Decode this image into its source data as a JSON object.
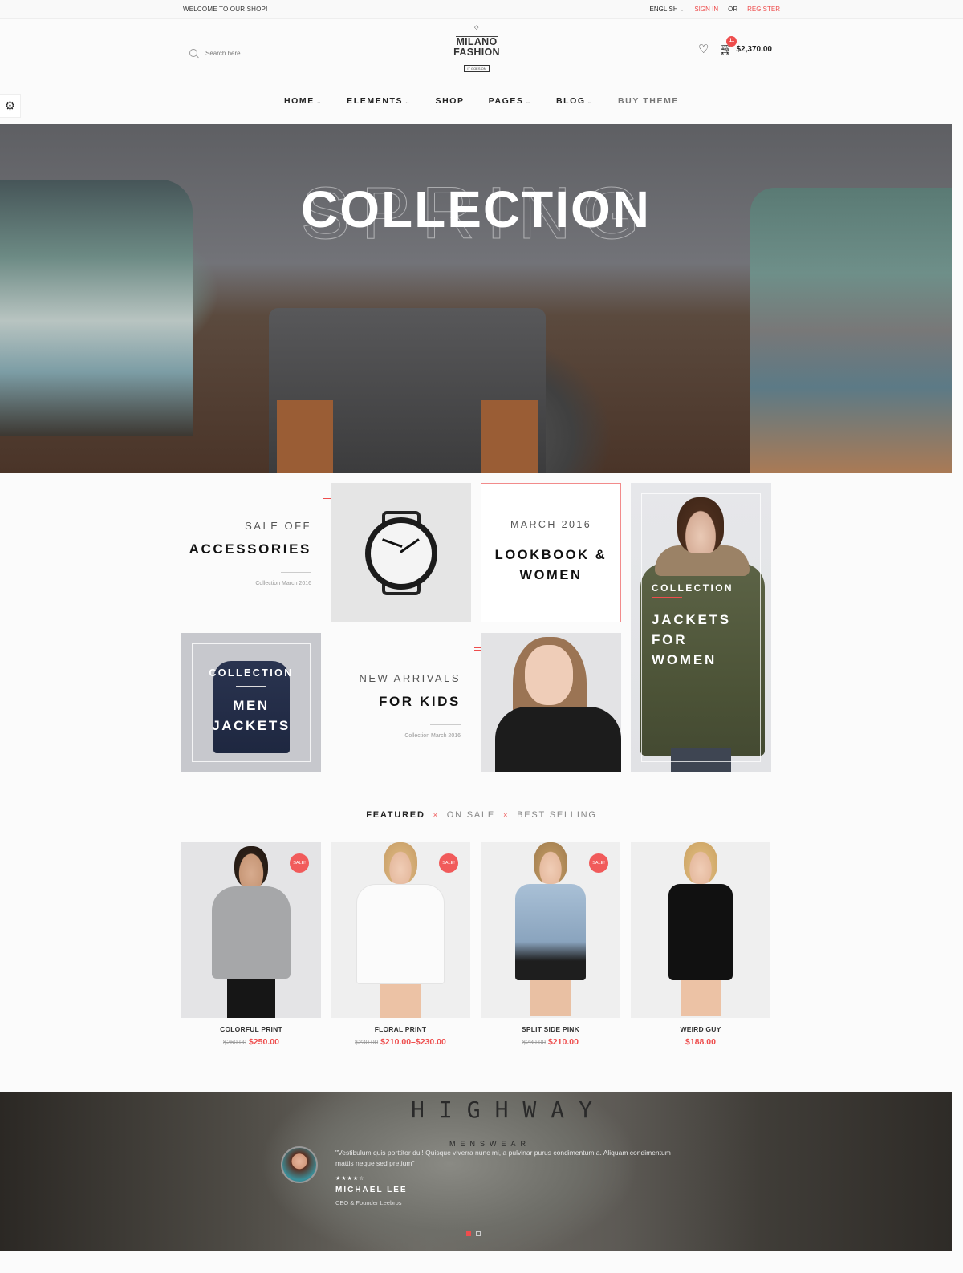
{
  "topbar": {
    "welcome": "WELCOME TO OUR SHOP!",
    "language": "ENGLISH",
    "sign_in": "SIGN IN",
    "or": "OR",
    "register": "REGISTER"
  },
  "header": {
    "search_placeholder": "Search here",
    "logo_line1": "MILANO",
    "logo_line2": "FASHION",
    "logo_tagline": "IT GOES ON",
    "wishlist_icon": "heart-icon",
    "cart_icon": "cart-icon",
    "cart_count": "11",
    "cart_total": "$2,370.00"
  },
  "nav": {
    "items": [
      {
        "label": "HOME",
        "dropdown": true
      },
      {
        "label": "ELEMENTS",
        "dropdown": true
      },
      {
        "label": "SHOP",
        "dropdown": false
      },
      {
        "label": "PAGES",
        "dropdown": true
      },
      {
        "label": "BLOG",
        "dropdown": true
      },
      {
        "label": "BUY THEME",
        "dropdown": false
      }
    ]
  },
  "settings_icon": "gear-icon",
  "hero": {
    "background_word": "SPRING",
    "title": "COLLECTION"
  },
  "promos": {
    "accessories": {
      "kicker": "SALE OFF",
      "title": "ACCESSORIES",
      "subtitle": "Collection March 2016"
    },
    "lookbook": {
      "kicker": "MARCH 2016",
      "title_line1": "LOOKBOOK &",
      "title_line2": "WOMEN"
    },
    "jackets_women": {
      "kicker": "COLLECTION",
      "title_line1": "JACKETS",
      "title_line2": "FOR",
      "title_line3": "WOMEN"
    },
    "men_jackets": {
      "kicker": "COLLECTION",
      "title_line1": "MEN",
      "title_line2": "JACKETS"
    },
    "kids": {
      "kicker": "NEW ARRIVALS",
      "title": "FOR KIDS",
      "subtitle": "Collection March 2016"
    }
  },
  "product_tabs": {
    "items": [
      "FEATURED",
      "ON SALE",
      "BEST SELLING"
    ],
    "separator": "×",
    "active": "FEATURED"
  },
  "products": [
    {
      "name": "COLORFUL PRINT",
      "old_price": "$260.00",
      "price": "$250.00",
      "sale": true
    },
    {
      "name": "FLORAL PRINT",
      "old_price": "$230.00",
      "price": "$210.00–$230.00",
      "sale": true
    },
    {
      "name": "SPLIT SIDE PINK",
      "old_price": "$230.00",
      "price": "$210.00",
      "sale": true
    },
    {
      "name": "WEIRD GUY",
      "old_price": null,
      "price": "$188.00",
      "sale": false
    }
  ],
  "sale_badge": "SALE!",
  "testimonial": {
    "sign_text": "HIGHWAY",
    "sign_sub": "MENSWEAR",
    "quote": "\"Vestibulum quis porttitor dui! Quisque viverra nunc mi, a pulvinar purus condimentum a. Aliquam condimentum mattis neque sed pretium\"",
    "rating": 4,
    "rating_max": 5,
    "stars": "★★★★☆",
    "author": "MICHAEL LEE",
    "role": "CEO & Founder Leebros",
    "slide_active": 1,
    "slide_count": 2
  },
  "colors": {
    "accent": "#ee4d4d",
    "text": "#222222",
    "muted": "#888888"
  }
}
